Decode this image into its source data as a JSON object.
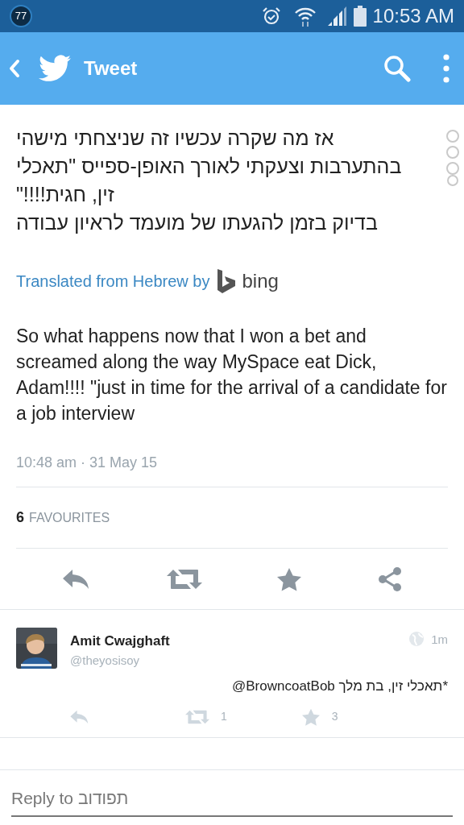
{
  "status_bar": {
    "badge": "77",
    "time": "10:53 AM"
  },
  "app_bar": {
    "title": "Tweet"
  },
  "tweet": {
    "text_lines": [
      "אז מה שקרה עכשיו זה שניצחתי מישהי",
      "בהתערבות וצעקתי לאורך האופן-ספייס \"תאכלי",
      "זין, חגית!!!!\"",
      "בדיוק בזמן להגעתו של מועמד לראיון עבודה"
    ],
    "translation": {
      "label": "Translated from Hebrew by",
      "provider": "bing"
    },
    "translated_text": "So what happens now that I won a bet and screamed along the way MySpace eat Dick, Adam!!!! \"just in time for the arrival of a candidate for a job interview",
    "timestamp": "10:48 am · 31 May 15",
    "favourites": {
      "count": "6",
      "label": "FAVOURITES"
    }
  },
  "reply": {
    "name": "Amit Cwajghaft",
    "handle": "@theyosisoy",
    "time": "1m",
    "text": "@BrowncoatBob תאכלי זין, בת מלך*",
    "retweets": "1",
    "favourites": "3"
  },
  "reply_field": {
    "placeholder": "Reply to תפודוב"
  }
}
